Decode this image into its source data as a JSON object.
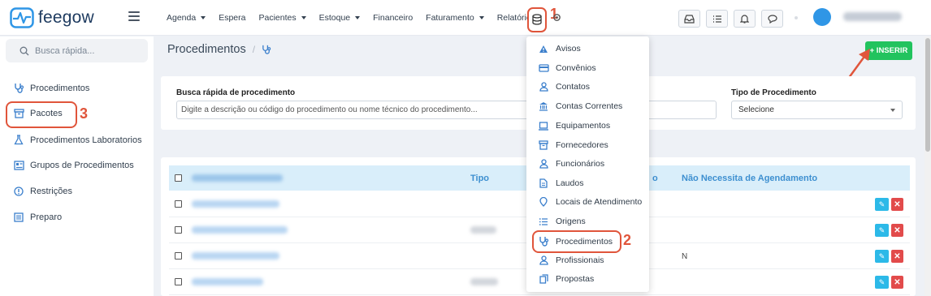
{
  "brand": {
    "name": "feegow"
  },
  "nav": {
    "items": [
      {
        "label": "Agenda",
        "caret": true
      },
      {
        "label": "Espera",
        "caret": false
      },
      {
        "label": "Pacientes",
        "caret": true
      },
      {
        "label": "Estoque",
        "caret": true
      },
      {
        "label": "Financeiro",
        "caret": false
      },
      {
        "label": "Faturamento",
        "caret": true
      },
      {
        "label": "Relatórios",
        "caret": false
      }
    ]
  },
  "annotations": {
    "n1": "1",
    "n2": "2",
    "n3": "3"
  },
  "sidebar": {
    "search_placeholder": "Busca rápida...",
    "items": [
      {
        "label": "Procedimentos",
        "icon": "stethoscope-icon"
      },
      {
        "label": "Pacotes",
        "icon": "box-icon"
      },
      {
        "label": "Procedimentos Laboratorios",
        "icon": "flask-icon"
      },
      {
        "label": "Grupos de Procedimentos",
        "icon": "grid-icon"
      },
      {
        "label": "Restrições",
        "icon": "info-icon"
      },
      {
        "label": "Preparo",
        "icon": "list-icon"
      }
    ]
  },
  "breadcrumb": {
    "title": "Procedimentos",
    "separator": "/"
  },
  "insert_button": {
    "label": "+ INSERIR"
  },
  "filters": {
    "search_label": "Busca rápida de procedimento",
    "search_placeholder": "Digite a descrição ou código do procedimento ou nome técnico do procedimento...",
    "type_label": "Tipo de Procedimento",
    "type_value": "Selecione"
  },
  "table": {
    "headers": {
      "tipo": "Tipo",
      "partial": "o",
      "nao": "Não Necessita de Agendamento"
    },
    "rows": [
      {
        "nao": ""
      },
      {
        "nao": ""
      },
      {
        "nao": "N"
      },
      {
        "nao": ""
      }
    ]
  },
  "dropdown": {
    "items": [
      {
        "label": "Avisos",
        "icon": "warning-icon"
      },
      {
        "label": "Convênios",
        "icon": "card-icon"
      },
      {
        "label": "Contatos",
        "icon": "user-icon"
      },
      {
        "label": "Contas Correntes",
        "icon": "bank-icon"
      },
      {
        "label": "Equipamentos",
        "icon": "laptop-icon"
      },
      {
        "label": "Fornecedores",
        "icon": "archive-icon"
      },
      {
        "label": "Funcionários",
        "icon": "user-icon"
      },
      {
        "label": "Laudos",
        "icon": "file-icon"
      },
      {
        "label": "Locais de Atendimento",
        "icon": "map-pin-icon"
      },
      {
        "label": "Origens",
        "icon": "list-icon"
      },
      {
        "label": "Procedimentos",
        "icon": "stethoscope-icon"
      },
      {
        "label": "Profissionais",
        "icon": "user-icon"
      },
      {
        "label": "Propostas",
        "icon": "copy-icon"
      }
    ]
  },
  "colors": {
    "accent": "#2f96e6",
    "annotation": "#e0553b",
    "success": "#22c35e",
    "header_bg": "#d9eefa"
  }
}
